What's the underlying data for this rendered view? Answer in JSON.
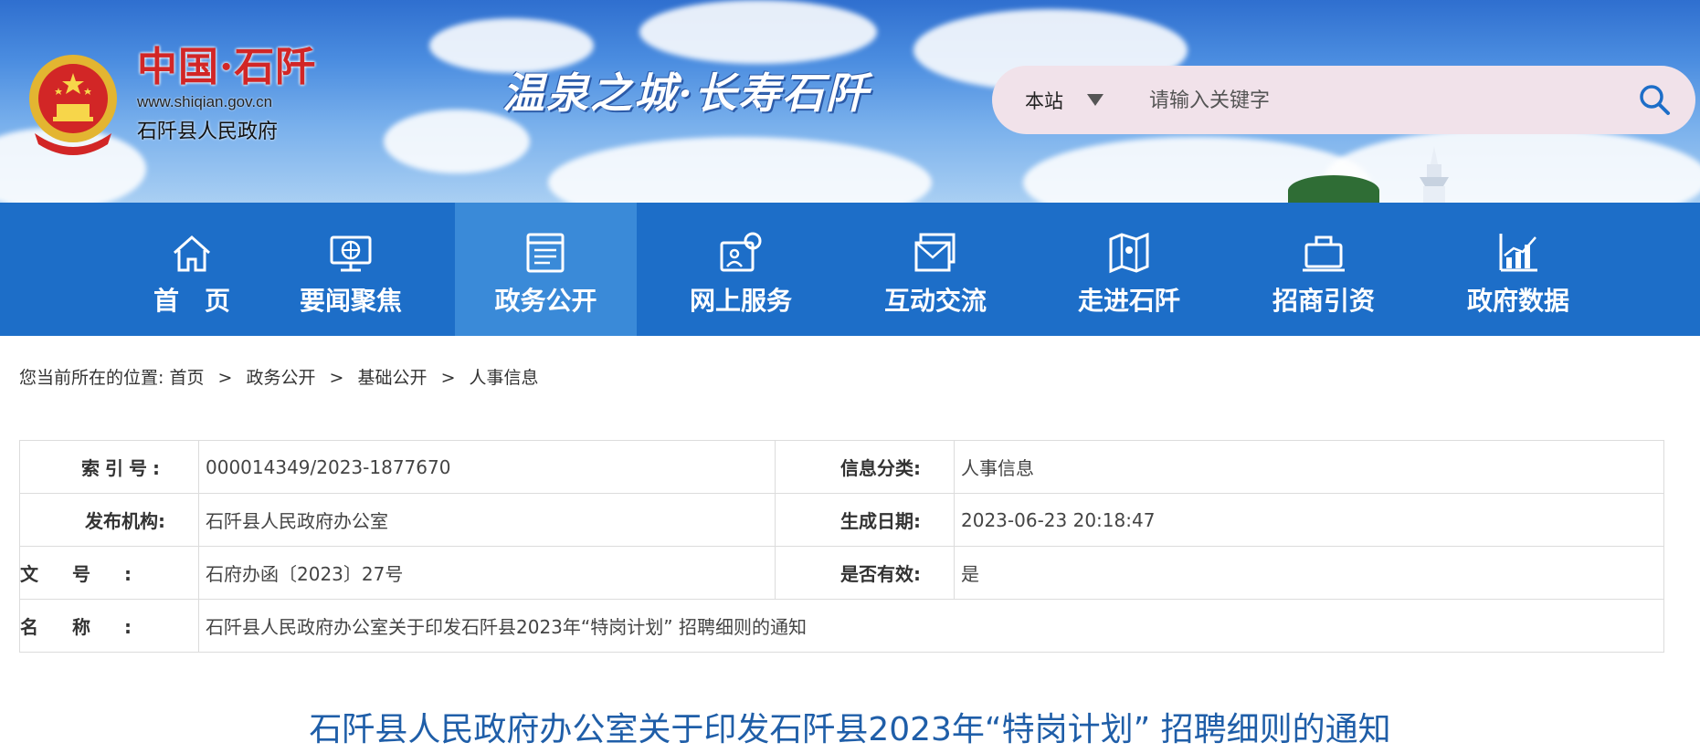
{
  "header": {
    "site_name_cn": "中国·石阡",
    "site_url": "www.shiqian.gov.cn",
    "site_gov": "石阡县人民政府",
    "slogan": "温泉之城·长寿石阡",
    "search": {
      "scope_label": "本站",
      "placeholder": "请输入关键字"
    }
  },
  "colors": {
    "nav_bg": "#1d6ec8",
    "nav_active_bg": "#3a8ad8",
    "title": "#1f5ea8",
    "emblem_red": "#d22626",
    "search_bg": "#f1e2ea"
  },
  "nav": {
    "items": [
      {
        "label": "首　页",
        "icon": "home-icon",
        "active": false
      },
      {
        "label": "要闻聚焦",
        "icon": "news-globe-icon",
        "active": false
      },
      {
        "label": "政务公开",
        "icon": "document-list-icon",
        "active": true
      },
      {
        "label": "网上服务",
        "icon": "online-service-icon",
        "active": false
      },
      {
        "label": "互动交流",
        "icon": "mail-icon",
        "active": false
      },
      {
        "label": "走进石阡",
        "icon": "map-icon",
        "active": false
      },
      {
        "label": "招商引资",
        "icon": "briefcase-icon",
        "active": false
      },
      {
        "label": "政府数据",
        "icon": "chart-icon",
        "active": false
      }
    ]
  },
  "breadcrumb": {
    "prefix": "您当前所在的位置:",
    "items": [
      "首页",
      "政务公开",
      "基础公开",
      "人事信息"
    ],
    "separator": ">"
  },
  "info": {
    "index_label": "索引号:",
    "index_value": "000014349/2023-1877670",
    "category_label": "信息分类:",
    "category_value": "人事信息",
    "org_label": "发布机构:",
    "org_value": "石阡县人民政府办公室",
    "date_label": "生成日期:",
    "date_value": "2023-06-23 20:18:47",
    "docno_label": "文号:",
    "docno_value": "石府办函〔2023〕27号",
    "valid_label": "是否有效:",
    "valid_value": "是",
    "name_label": "名称:",
    "name_value": "石阡县人民政府办公室关于印发石阡县2023年“特岗计划” 招聘细则的通知"
  },
  "document": {
    "title": "石阡县人民政府办公室关于印发石阡县2023年“特岗计划” 招聘细则的通知"
  }
}
